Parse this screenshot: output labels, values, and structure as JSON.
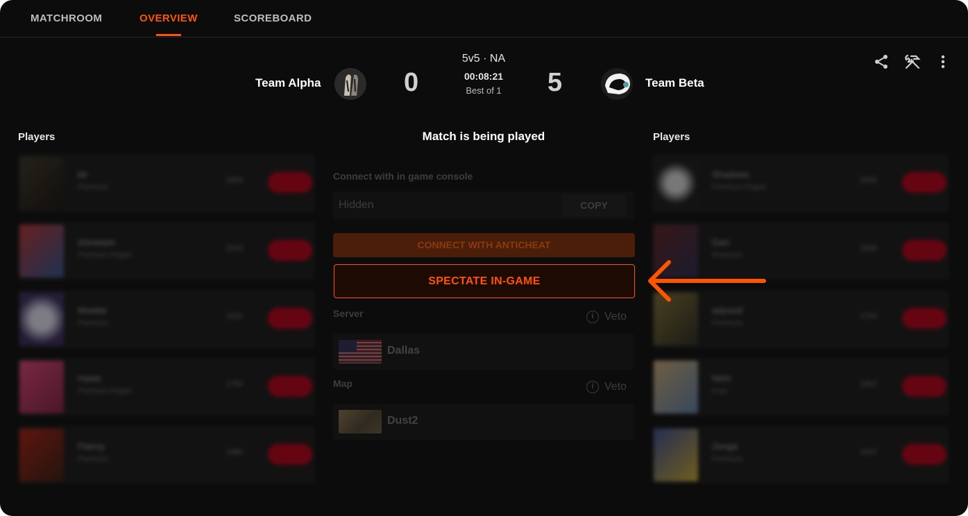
{
  "nav": {
    "tabs": [
      {
        "label": "MATCHROOM"
      },
      {
        "label": "OVERVIEW"
      },
      {
        "label": "SCOREBOARD"
      }
    ],
    "active_tab": "OVERVIEW"
  },
  "match": {
    "team1": {
      "name": "Team Alpha",
      "score": "0"
    },
    "team2": {
      "name": "Team Beta",
      "score": "5"
    },
    "mode": "5v5 · NA",
    "timer": "00:08:21",
    "best_of": "Best of 1",
    "status": "Match is being played"
  },
  "left_players": {
    "title": "Players",
    "items": [
      {
        "name": "blr",
        "sub": "Premium",
        "elo": "1850"
      },
      {
        "name": "shinetwin",
        "sub": "Premium Player",
        "elo": "1923"
      },
      {
        "name": "Mowbe",
        "sub": "Premium",
        "elo": "2011"
      },
      {
        "name": "Haste",
        "sub": "Premium Player",
        "elo": "1764"
      },
      {
        "name": "Flanny",
        "sub": "Premium",
        "elo": "1980"
      }
    ]
  },
  "right_players": {
    "title": "Players",
    "items": [
      {
        "name": "Shadows",
        "sub": "Premium Player",
        "elo": "2055"
      },
      {
        "name": "Dart",
        "sub": "Premium",
        "elo": "1899"
      },
      {
        "name": "adyssid",
        "sub": "Premium",
        "elo": "1744"
      },
      {
        "name": "Nehi",
        "sub": "Free",
        "elo": "1802"
      },
      {
        "name": "Zenga",
        "sub": "Premium",
        "elo": "1937"
      }
    ]
  },
  "connect": {
    "label": "Connect with in game console",
    "value": "Hidden",
    "copy_label": "COPY",
    "anticheat_label": "CONNECT WITH ANTICHEAT",
    "spectate_label": "SPECTATE IN-GAME"
  },
  "server": {
    "label": "Server",
    "veto_label": "Veto",
    "value": "Dallas"
  },
  "map": {
    "label": "Map",
    "veto_label": "Veto",
    "value": "Dust2"
  },
  "colors": {
    "accent": "#ff5500",
    "background": "#0c0c0c",
    "level_badge": "#b00018"
  },
  "icons": [
    "share-icon",
    "tools-icon",
    "more-icon",
    "info-icon",
    "arrow-icon"
  ]
}
